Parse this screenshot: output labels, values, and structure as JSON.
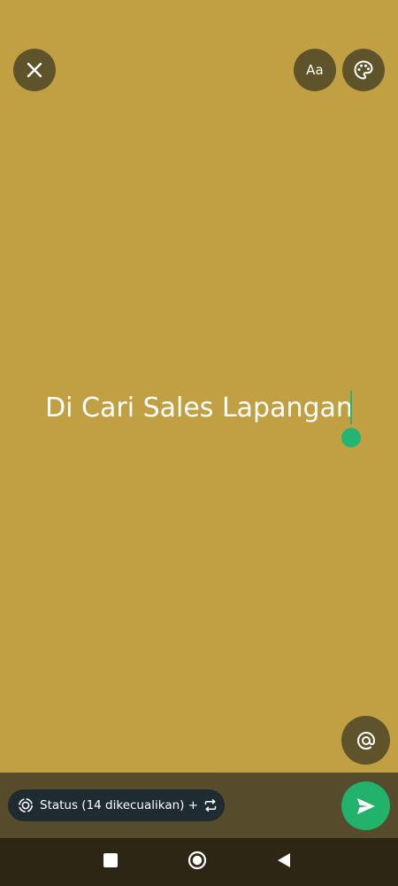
{
  "status_editor": {
    "text": "Di Cari Sales Lapangan",
    "background_color": "#C0A042",
    "caret_color": "#22B573"
  },
  "toolbar": {
    "close_icon": "close-icon",
    "font_label": "Aa",
    "palette_icon": "palette-icon"
  },
  "mention": {
    "icon": "at-sign-icon"
  },
  "audience": {
    "icon": "status-icon",
    "label": "Status (14 dikecualikan) +",
    "arrows_icon": "repeat-icon"
  },
  "send": {
    "icon": "send-icon",
    "color": "#21B36B"
  },
  "navigation": {
    "recents_icon": "square-icon",
    "home_icon": "circle-home-icon",
    "back_icon": "triangle-back-icon"
  }
}
